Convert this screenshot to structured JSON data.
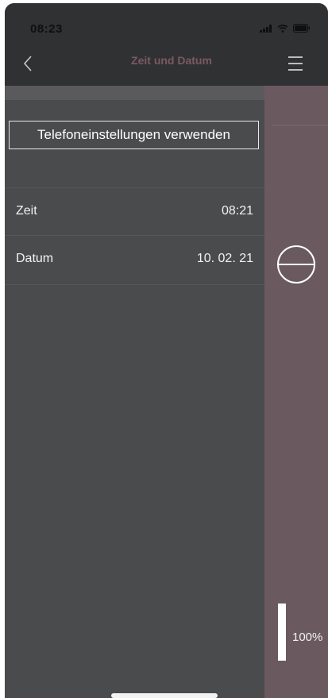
{
  "status_bar": {
    "time": "08:23",
    "icons": [
      "signal-icon",
      "wifi-icon",
      "battery-icon"
    ]
  },
  "nav": {
    "title": "Zeit und Datum",
    "back_icon": "chevron-left-icon",
    "menu_icon": "hamburger-menu-icon"
  },
  "settings": {
    "use_phone_settings_label": "Telefoneinstellungen verwenden",
    "rows": [
      {
        "label": "Zeit",
        "value": "08:21"
      },
      {
        "label": "Datum",
        "value": "10. 02. 21"
      }
    ]
  },
  "side_panel": {
    "minus_icon": "minus-circle-icon",
    "level_text": "100%",
    "level_fraction": 1.0
  },
  "colors": {
    "header_bg": "#303133",
    "panel_bg": "#4a4b4d",
    "side_bg": "#6a5a60",
    "title_color": "#7a5a62"
  }
}
